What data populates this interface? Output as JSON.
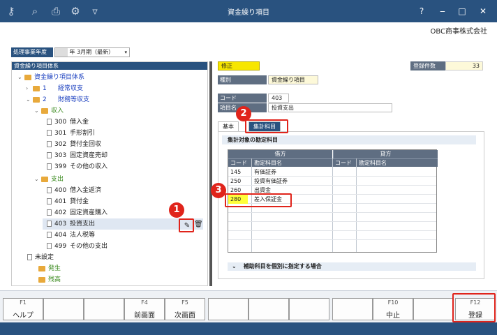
{
  "window": {
    "title": "資金繰り項目",
    "company": "OBC商事株式会社",
    "toolbar_icons": [
      "key-search-icon",
      "magnifier-icon",
      "printer-icon",
      "settings-icon",
      "filter-icon"
    ],
    "controls": {
      "minimize": "‒",
      "restore": "□",
      "close": "✕",
      "menu": "?"
    }
  },
  "fiscal_year": {
    "label": "処理事業年度",
    "value": "年 3月期（最新）"
  },
  "tree": {
    "header": "資金繰り項目体系",
    "root": "資金繰り項目体系",
    "items": [
      {
        "code": "1",
        "label": "経常収支"
      },
      {
        "code": "2",
        "label": "財務等収支"
      },
      {
        "code": "",
        "label": "収入"
      },
      {
        "code": "300",
        "label": "借入金"
      },
      {
        "code": "301",
        "label": "手形割引"
      },
      {
        "code": "302",
        "label": "貸付金回収"
      },
      {
        "code": "303",
        "label": "固定資産売却"
      },
      {
        "code": "399",
        "label": "その他の収入"
      },
      {
        "code": "",
        "label": "支出"
      },
      {
        "code": "400",
        "label": "借入金返済"
      },
      {
        "code": "401",
        "label": "貸付金"
      },
      {
        "code": "402",
        "label": "固定資産購入"
      },
      {
        "code": "403",
        "label": "投資支出"
      },
      {
        "code": "404",
        "label": "法人税等"
      },
      {
        "code": "499",
        "label": "その他の支出"
      },
      {
        "code": "",
        "label": "未設定"
      },
      {
        "code": "",
        "label": "発生"
      },
      {
        "code": "",
        "label": "残高"
      }
    ]
  },
  "detail": {
    "mode": "修正",
    "count_label": "登録件数",
    "count_value": "33",
    "kind_label": "種別",
    "kind_value": "資金繰り項目",
    "code_label": "コード",
    "code_value": "403",
    "name_label": "項目名",
    "name_value": "投資支出",
    "tabs": [
      "基本",
      "集計科目"
    ],
    "section_title": "集計対象の勘定科目",
    "debit_header": "借方",
    "credit_header": "貸方",
    "col_code": "コード",
    "col_name": "勘定科目名",
    "rows": [
      {
        "code": "145",
        "name": "有価証券"
      },
      {
        "code": "250",
        "name": "投資有価証券"
      },
      {
        "code": "260",
        "name": "出資金"
      },
      {
        "code": "280",
        "name": "差入保証金"
      }
    ],
    "aux_section": "補助科目を個別に指定する場合"
  },
  "function_keys": [
    {
      "key": "F1",
      "label": "ヘルプ"
    },
    {
      "key": "",
      "label": ""
    },
    {
      "key": "",
      "label": ""
    },
    {
      "key": "F4",
      "label": "前画面"
    },
    {
      "key": "F5",
      "label": "次画面"
    },
    {
      "key": "",
      "label": ""
    },
    {
      "key": "",
      "label": ""
    },
    {
      "key": "",
      "label": ""
    },
    {
      "key": "",
      "label": ""
    },
    {
      "key": "F10",
      "label": "中止"
    },
    {
      "key": "",
      "label": ""
    },
    {
      "key": "F12",
      "label": "登録"
    }
  ],
  "callouts": [
    "1",
    "2",
    "3"
  ],
  "colors": {
    "accent": "#29527f",
    "highlight": "#ffff3a",
    "callout": "#e0241b",
    "mode_badge": "#f7e600"
  }
}
